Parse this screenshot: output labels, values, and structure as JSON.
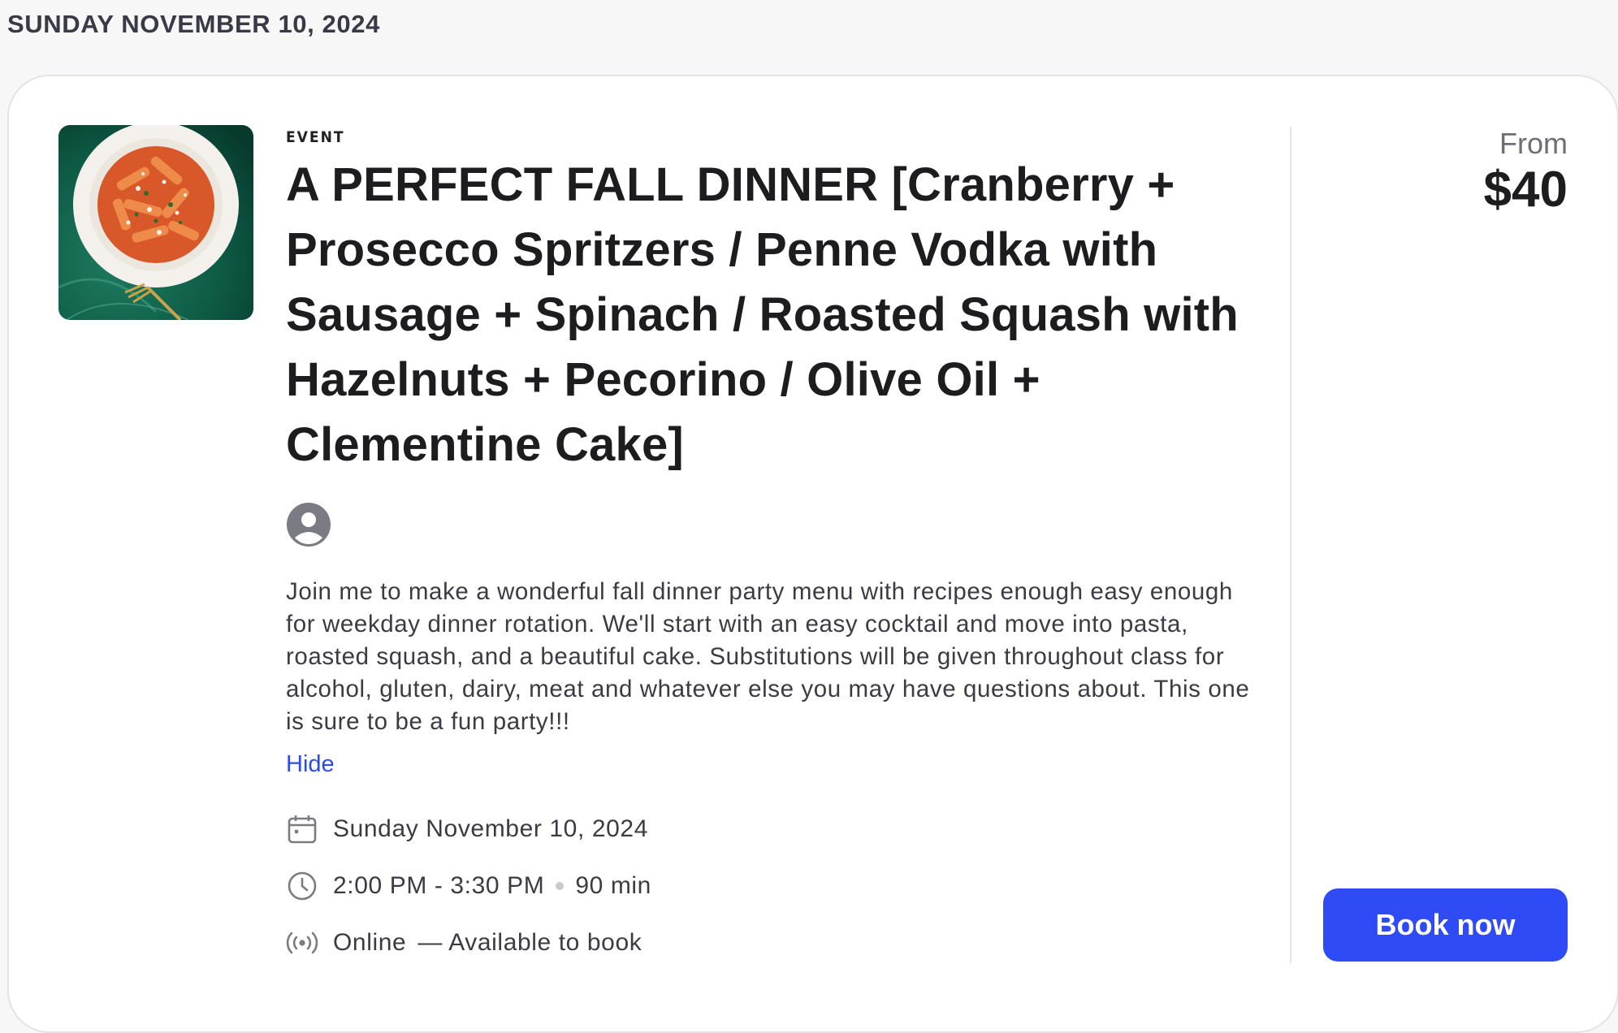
{
  "page": {
    "date_heading": "SUNDAY NOVEMBER 10, 2024"
  },
  "event": {
    "kicker": "EVENT",
    "title": "A PERFECT FALL DINNER [Cranberry + Prosecco Spritzers / Penne Vodka with Sausage + Spinach / Roasted Squash with Hazelnuts + Pecorino / Olive Oil + Clementine Cake]",
    "description": "Join me to make a wonderful fall dinner party menu with recipes enough easy enough for weekday dinner rotation. We'll start with an easy cocktail and move into pasta, roasted squash, and a beautiful cake. Substitutions will be given throughout class for alcohol, gluten, dairy, meat and whatever else you may have questions about. This one is sure to be a fun party!!!",
    "hide_label": "Hide",
    "date": "Sunday November 10, 2024",
    "time_range": "2:00 PM - 3:30 PM",
    "duration": "90 min",
    "location": "Online",
    "availability": "— Available to book",
    "thumbnail_icon": "pasta-dish-image",
    "host_icon": "user-avatar-icon"
  },
  "pricing": {
    "from_label": "From",
    "price": "$40",
    "book_label": "Book now"
  },
  "colors": {
    "accent": "#2f4bf5",
    "link": "#2b4bf2",
    "thumbnail_bg": "#0e5a45"
  }
}
